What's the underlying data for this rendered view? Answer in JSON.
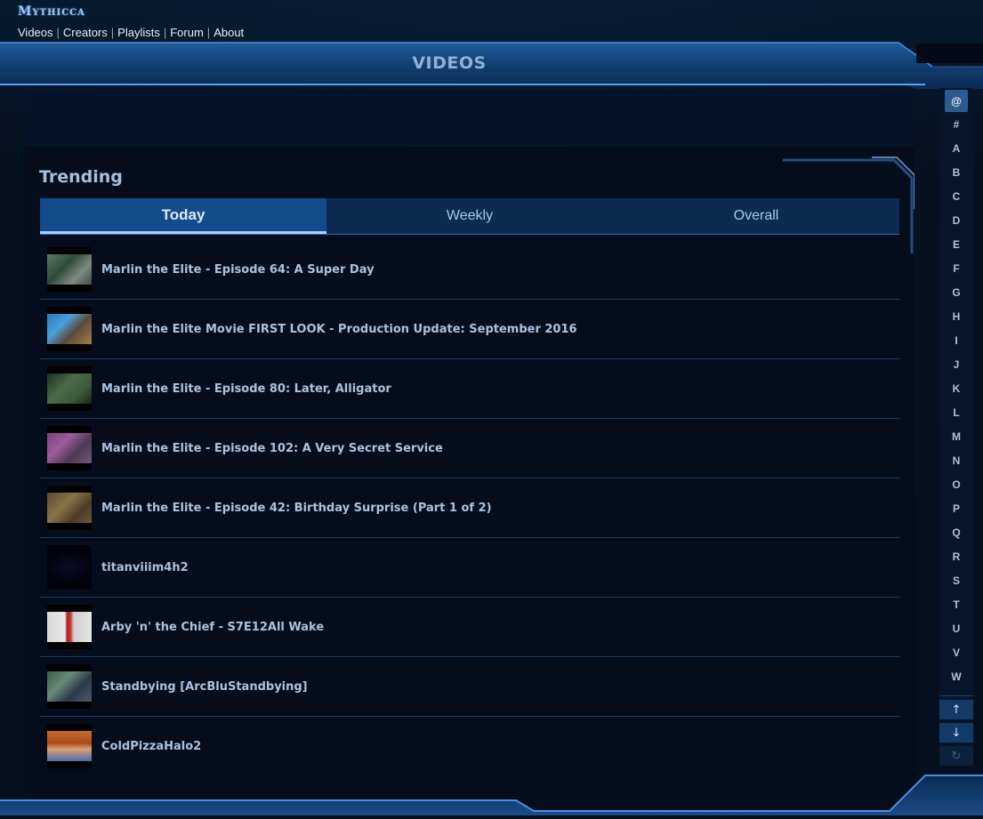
{
  "brand": {
    "logo_text": "Mythicca"
  },
  "nav": {
    "items": [
      "Videos",
      "Creators",
      "Playlists",
      "Forum",
      "About"
    ],
    "separator": "|"
  },
  "page": {
    "title": "VIDEOS"
  },
  "trending": {
    "heading": "Trending",
    "tabs": [
      "Today",
      "Weekly",
      "Overall"
    ],
    "active_tab": "Today",
    "videos": [
      {
        "title": "Marlin the Elite - Episode 64: A Super Day"
      },
      {
        "title": "Marlin the Elite Movie FIRST LOOK - Production Update: September 2016"
      },
      {
        "title": "Marlin the Elite - Episode 80: Later, Alligator"
      },
      {
        "title": "Marlin the Elite - Episode 102: A Very Secret Service"
      },
      {
        "title": "Marlin the Elite - Episode 42: Birthday Surprise (Part 1 of 2)"
      },
      {
        "title": "titanviiim4h2"
      },
      {
        "title": "Arby 'n' the Chief - S7E12All Wake"
      },
      {
        "title": "Standbying [ArcBluStandbying]"
      },
      {
        "title": "ColdPizzaHalo2"
      }
    ]
  },
  "alphabet": {
    "letters": [
      "@",
      "#",
      "A",
      "B",
      "C",
      "D",
      "E",
      "F",
      "G",
      "H",
      "I",
      "J",
      "K",
      "L",
      "M",
      "N",
      "O",
      "P",
      "Q",
      "R",
      "S",
      "T",
      "U",
      "V",
      "W"
    ],
    "active": "@",
    "controls": {
      "up": "↑",
      "down": "↓",
      "refresh": "↻"
    }
  },
  "colors": {
    "accent": "#134c8c",
    "panel": "#050d1c",
    "text": "#aac2e0"
  }
}
